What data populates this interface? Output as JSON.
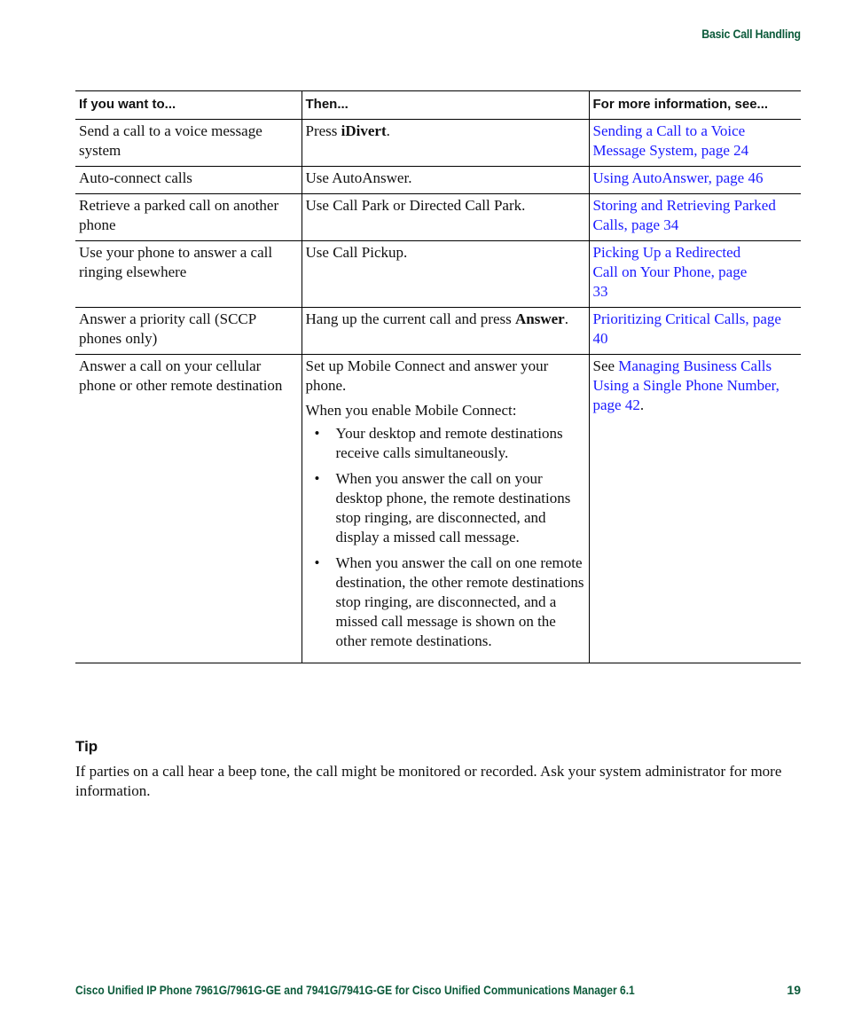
{
  "header": {
    "section_title": "Basic Call Handling"
  },
  "table": {
    "columns": [
      "If you want to...",
      "Then...",
      "For more information, see..."
    ],
    "rows": [
      {
        "want": "Send a call to a voice message system",
        "then_pre": "Press ",
        "then_bold": "iDivert",
        "then_post": ".",
        "see": "Sending a Call to a Voice Message System, page 24"
      },
      {
        "want": "Auto-connect calls",
        "then": "Use AutoAnswer.",
        "see": "Using AutoAnswer, page 46"
      },
      {
        "want": "Retrieve a parked call on another phone",
        "then": "Use Call Park or Directed Call Park.",
        "see": "Storing and Retrieving Parked Calls, page 34"
      },
      {
        "want": "Use your phone to answer a call ringing elsewhere",
        "then": "Use Call Pickup.",
        "see": "Picking Up a Redirected Call on Your Phone, page 33"
      },
      {
        "want": "Answer a priority call (SCCP phones only)",
        "then_pre": "Hang up the current call and press ",
        "then_bold": "Answer",
        "then_post": ".",
        "see": "Prioritizing Critical Calls, page 40"
      },
      {
        "want": "Answer a call on your cellular phone or other remote destination",
        "then": "Set up Mobile Connect and answer your phone.",
        "then_intro": "When you enable Mobile Connect:",
        "bullets": [
          "Your desktop and remote destinations receive calls simultaneously.",
          "When you answer the call on your desktop phone, the remote destinations stop ringing, are disconnected, and display a missed call message.",
          "When you answer the call on one remote destination, the other remote destinations stop ringing, are disconnected, and a missed call message is shown on the other remote destinations."
        ],
        "see_pre": "See ",
        "see": "Managing Business Calls Using a Single Phone Number, page 42",
        "see_post": "."
      }
    ]
  },
  "tip": {
    "heading": "Tip",
    "text": "If parties on a call hear a beep tone, the call might be monitored or recorded. Ask your system administrator for more information."
  },
  "footer": {
    "title": "Cisco Unified IP Phone 7961G/7961G-GE and 7941G/7941G-GE for Cisco Unified Communications Manager 6.1",
    "page_number": "19"
  },
  "colors": {
    "brand_green": "#0b5a3a",
    "link_blue": "#1a1aff"
  }
}
